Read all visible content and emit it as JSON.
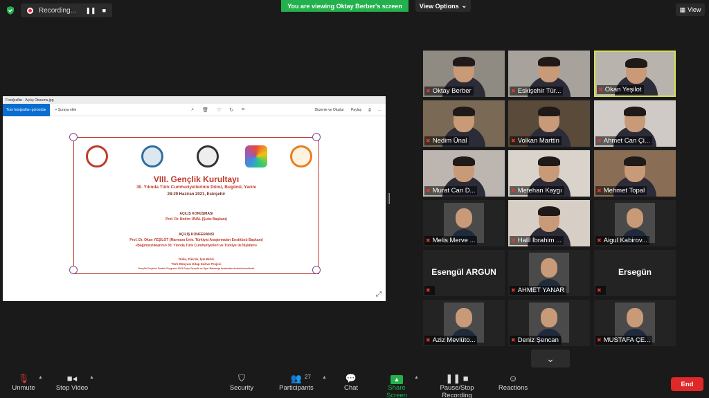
{
  "recording": {
    "label": "Recording..."
  },
  "banner": {
    "viewing": "You are viewing Oktay Berber's screen",
    "view_options": "View Options",
    "view": "View"
  },
  "shared": {
    "window_title": "Fotoğraflar - Açılış Oturumu.jpg",
    "view_all": "Tüm fotoğrafları görüntüle",
    "add_to": "Şuraya ekle",
    "edit_create": "Düzenle ve Oluştur",
    "share": "Paylaş",
    "poster": {
      "title": "VIII. Gençlik Kurultayı",
      "subtitle": "30. Yılında Türk Cumhuriyetlerinin Dünü, Bugünü, Yarını",
      "date": "28-29 Haziran 2021, Eskişehir",
      "opening_speech": "AÇILIŞ KONUŞMASI",
      "opening_speaker": "Prof. Dr. Nedim ÜNAL (Şube Başkanı)",
      "opening_conf": "AÇILIŞ KONFERANSI",
      "conf_speaker": "Prof. Dr. Okan YEŞİLOT (Marmara Üniv. Türkiyat Araştırmaları Enstitüsü Başkanı)",
      "conf_topic": "«Bağımsızlıklarının 30. Yılında Türk Cumhuriyetleri ve Türkiye ile İlişkileri»",
      "motto": "Dilde, Fikirde, İşte Birlik",
      "project": "Türk Dünyası Kitap Kahve Projesi",
      "footer": "Gençlik Projeleri Destek Programı 2021 Proje Gençlik ve Spor Bakanlığı tarafından desteklenmektedir"
    }
  },
  "participants": [
    {
      "name": "Oktay Berber",
      "type": "video",
      "active": false
    },
    {
      "name": "Eskişehir Tür...",
      "type": "video",
      "active": false
    },
    {
      "name": "Okan Yeşilot",
      "type": "video",
      "active": true
    },
    {
      "name": "Nedim Ünal",
      "type": "video",
      "active": false
    },
    {
      "name": "Volkan Marttin",
      "type": "video",
      "active": false
    },
    {
      "name": "Ahmet Can Çi...",
      "type": "video",
      "active": false
    },
    {
      "name": "Murat Can D...",
      "type": "video",
      "active": false
    },
    {
      "name": "Metehan Kaygı",
      "type": "video",
      "active": false
    },
    {
      "name": "Mehmet Topal",
      "type": "video",
      "active": false
    },
    {
      "name": "Melis Merve ...",
      "type": "photo",
      "active": false
    },
    {
      "name": "Halil İbrahim ...",
      "type": "video",
      "active": false
    },
    {
      "name": "Aigul Kabirov...",
      "type": "photo",
      "active": false
    },
    {
      "name": "Esengül ARGUN",
      "type": "name",
      "active": false
    },
    {
      "name": "AHMET YANAR",
      "type": "photo",
      "active": false
    },
    {
      "name": "Ersegün",
      "type": "name",
      "active": false
    },
    {
      "name": "Aziz Mevlüto...",
      "type": "photo",
      "active": false
    },
    {
      "name": "Deniz Şencan",
      "type": "photo",
      "active": false
    },
    {
      "name": "MUSTAFA ÇE...",
      "type": "photo",
      "active": false
    }
  ],
  "toolbar": {
    "unmute": "Unmute",
    "stop_video": "Stop Video",
    "security": "Security",
    "participants": "Participants",
    "participants_count": "27",
    "chat": "Chat",
    "share_screen": "Share Screen",
    "record": "Pause/Stop Recording",
    "reactions": "Reactions",
    "end": "End"
  },
  "colors": {
    "accent_green": "#23b14d",
    "end_red": "#e02828",
    "active_border": "#d4e157",
    "poster_red": "#c0392b"
  }
}
